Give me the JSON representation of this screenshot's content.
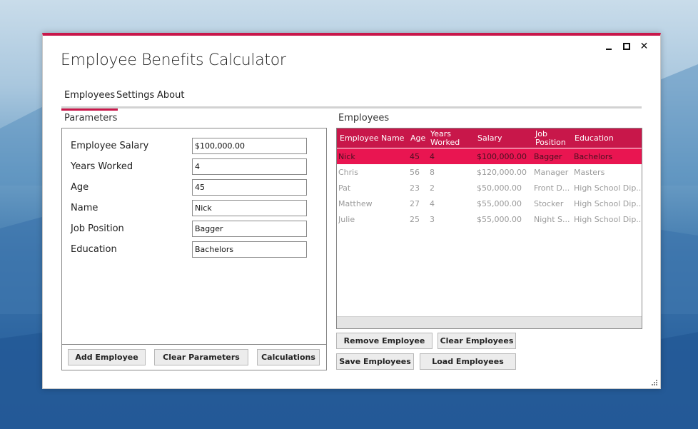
{
  "window": {
    "title": "Employee Benefits Calculator",
    "accent_color": "#c8174a",
    "controls": {
      "minimize_icon": "minimize-icon",
      "maximize_icon": "maximize-icon",
      "close_icon": "close-icon",
      "close_label": "✕"
    }
  },
  "tabs": [
    {
      "label": "Employees",
      "active": true
    },
    {
      "label": "Settings",
      "active": false
    },
    {
      "label": "About",
      "active": false
    }
  ],
  "parameters": {
    "section_label": "Parameters",
    "fields": [
      {
        "label": "Employee Salary",
        "value": "$100,000.00"
      },
      {
        "label": "Years Worked",
        "value": "4"
      },
      {
        "label": "Age",
        "value": "45"
      },
      {
        "label": "Name",
        "value": "Nick"
      },
      {
        "label": "Job Position",
        "value": "Bagger"
      },
      {
        "label": "Education",
        "value": "Bachelors"
      }
    ],
    "buttons": {
      "add": "Add Employee",
      "clear": "Clear Parameters",
      "calculations": "Calculations"
    }
  },
  "employees": {
    "section_label": "Employees",
    "columns": {
      "name": "Employee Name",
      "age": "Age",
      "years": "Years Worked",
      "salary": "Salary",
      "position": "Job Position",
      "education": "Education"
    },
    "rows": [
      {
        "name": "Nick",
        "age": "45",
        "years": "4",
        "salary": "$100,000.00",
        "position": "Bagger",
        "education": "Bachelors",
        "selected": true
      },
      {
        "name": "Chris",
        "age": "56",
        "years": "8",
        "salary": "$120,000.00",
        "position": "Manager",
        "education": "Masters",
        "selected": false
      },
      {
        "name": "Pat",
        "age": "23",
        "years": "2",
        "salary": "$50,000.00",
        "position": "Front D...",
        "education": "High School Dip...",
        "selected": false
      },
      {
        "name": "Matthew",
        "age": "27",
        "years": "4",
        "salary": "$55,000.00",
        "position": "Stocker",
        "education": "High School Dip...",
        "selected": false
      },
      {
        "name": "Julie",
        "age": "25",
        "years": "3",
        "salary": "$55,000.00",
        "position": "Night S...",
        "education": "High School Dip...",
        "selected": false
      }
    ],
    "buttons": {
      "remove": "Remove Employee",
      "clear": "Clear Employees",
      "save": "Save Employees",
      "load": "Load Employees"
    }
  }
}
